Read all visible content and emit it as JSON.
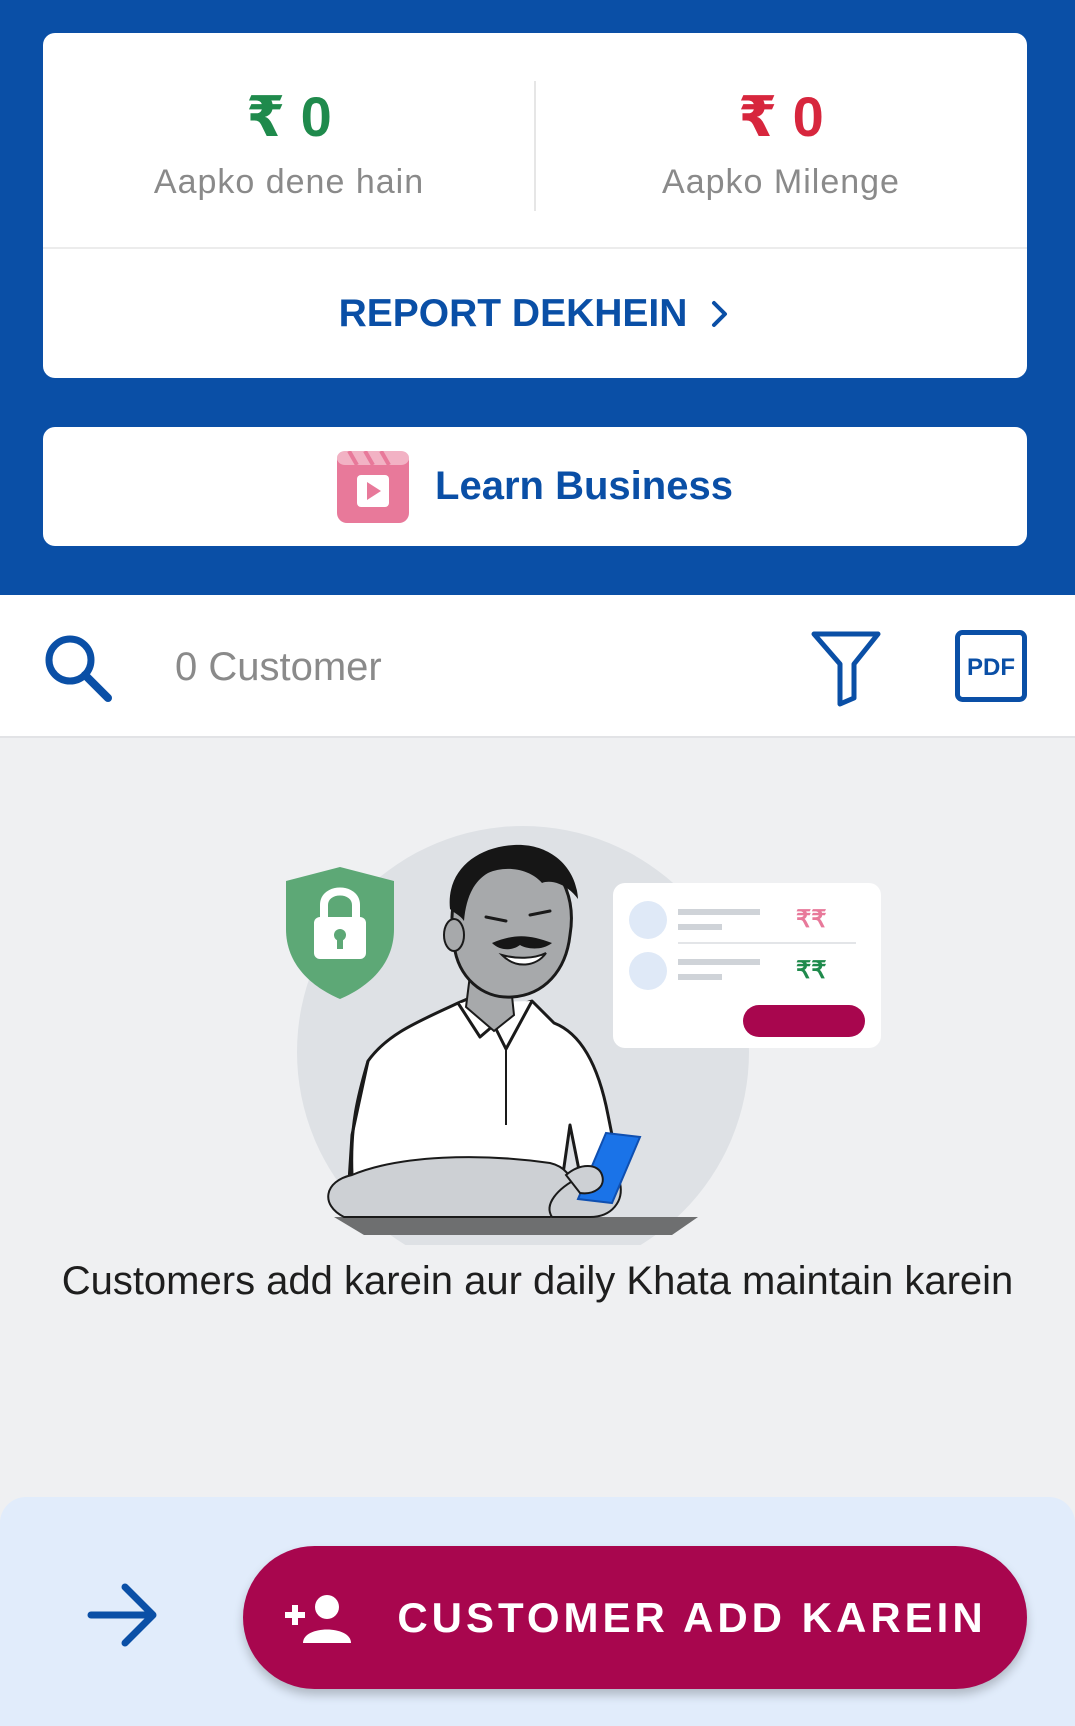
{
  "colors": {
    "brand_blue": "#0a4fa6",
    "green_amount": "#1f8a4c",
    "red_amount": "#d7263d",
    "cta": "#a8064e",
    "bottom_bar": "#e1ecfb"
  },
  "summary": {
    "give": {
      "amount": "₹ 0",
      "label": "Aapko dene hain"
    },
    "get": {
      "amount": "₹ 0",
      "label": "Aapko Milenge"
    },
    "report_label": "REPORT DEKHEIN",
    "report_icon": "chevron-right-icon"
  },
  "learn": {
    "label": "Learn Business",
    "icon": "video-play-icon"
  },
  "search_bar": {
    "search_icon": "search-icon",
    "customer_count": "0 Customer",
    "filter_icon": "filter-icon",
    "pdf_icon": "PDF"
  },
  "empty_state": {
    "illustration": "shopkeeper-with-phone-illustration",
    "rupee_marks": [
      "₹₹",
      "₹₹"
    ],
    "text": "Customers add karein aur daily Khata maintain karein"
  },
  "bottom": {
    "arrow_icon": "arrow-right-icon",
    "add_icon": "add-person-icon",
    "add_label": "CUSTOMER ADD KAREIN"
  }
}
